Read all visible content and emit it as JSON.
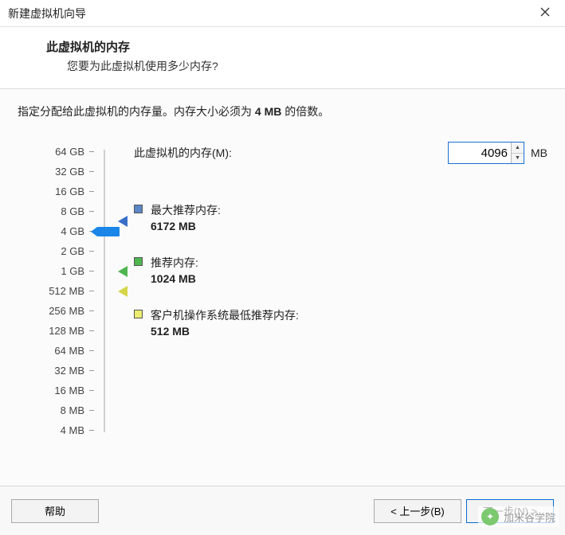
{
  "window": {
    "title": "新建虚拟机向导"
  },
  "header": {
    "title": "此虚拟机的内存",
    "subtitle": "您要为此虚拟机使用多少内存?"
  },
  "instruction": {
    "prefix": "指定分配给此虚拟机的内存量。内存大小必须为 ",
    "bold": "4 MB",
    "suffix": " 的倍数。"
  },
  "memory": {
    "label": "此虚拟机的内存(M):",
    "value": "4096",
    "unit": "MB",
    "scale": [
      "64 GB",
      "32 GB",
      "16 GB",
      "8 GB",
      "4 GB",
      "2 GB",
      "1 GB",
      "512 MB",
      "256 MB",
      "128 MB",
      "64 MB",
      "32 MB",
      "16 MB",
      "8 MB",
      "4 MB"
    ],
    "current_index": 4,
    "markers": {
      "max": {
        "label": "最大推荐内存:",
        "value": "6172 MB",
        "approx_index": 3.5
      },
      "rec": {
        "label": "推荐内存:",
        "value": "1024 MB",
        "approx_index": 6
      },
      "min": {
        "label": "客户机操作系统最低推荐内存:",
        "value": "512 MB",
        "approx_index": 7
      }
    }
  },
  "footer": {
    "help": "帮助",
    "back": "< 上一步(B)",
    "next": "下一步(N) >",
    "cancel_visible": false
  },
  "watermark": {
    "text": "加米谷学院"
  }
}
